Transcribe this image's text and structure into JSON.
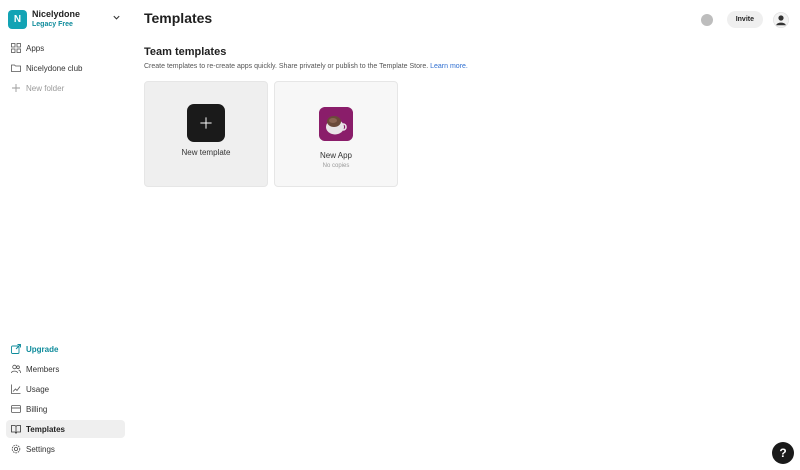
{
  "team": {
    "initial": "N",
    "name": "Nicelydone",
    "plan": "Legacy Free"
  },
  "sidebar": {
    "top_items": [
      {
        "label": "Apps"
      },
      {
        "label": "Nicelydone club"
      },
      {
        "label": "New folder"
      }
    ],
    "bottom_items": [
      {
        "label": "Upgrade"
      },
      {
        "label": "Members"
      },
      {
        "label": "Usage"
      },
      {
        "label": "Billing"
      },
      {
        "label": "Templates"
      },
      {
        "label": "Settings"
      }
    ]
  },
  "header": {
    "title": "Templates",
    "invite_label": "Invite"
  },
  "section": {
    "title": "Team templates",
    "description": "Create templates to re-create apps quickly. Share privately or publish to the Template Store.",
    "link_label": "Learn more."
  },
  "cards": [
    {
      "label": "New template"
    },
    {
      "label": "New App",
      "sub": "No copies"
    }
  ],
  "help": {
    "label": "?"
  },
  "colors": {
    "accent": "#12a3b4",
    "link": "#2f6fd1",
    "app_icon_bg": "#8a1d6a"
  }
}
